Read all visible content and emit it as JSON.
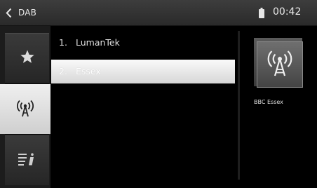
{
  "header": {
    "back_icon": "chevron-left-icon",
    "title": "DAB",
    "battery_icon": "battery-icon",
    "time": "00:42"
  },
  "tabs": [
    {
      "id": "favorites",
      "icon": "star-icon",
      "active": false
    },
    {
      "id": "stations",
      "icon": "broadcast-antenna-icon",
      "active": true
    },
    {
      "id": "info",
      "icon": "text-info-icon",
      "active": false
    }
  ],
  "stations": [
    {
      "number": "1.",
      "name": "LumanTek",
      "selected": false
    },
    {
      "number": "2.",
      "name": "Essex",
      "selected": true
    }
  ],
  "detail": {
    "icon": "broadcast-antenna-icon",
    "station_name": "BBC Essex"
  },
  "colors": {
    "background": "#000000",
    "status_bar": "#333333",
    "selection": "#e8e8e8"
  }
}
